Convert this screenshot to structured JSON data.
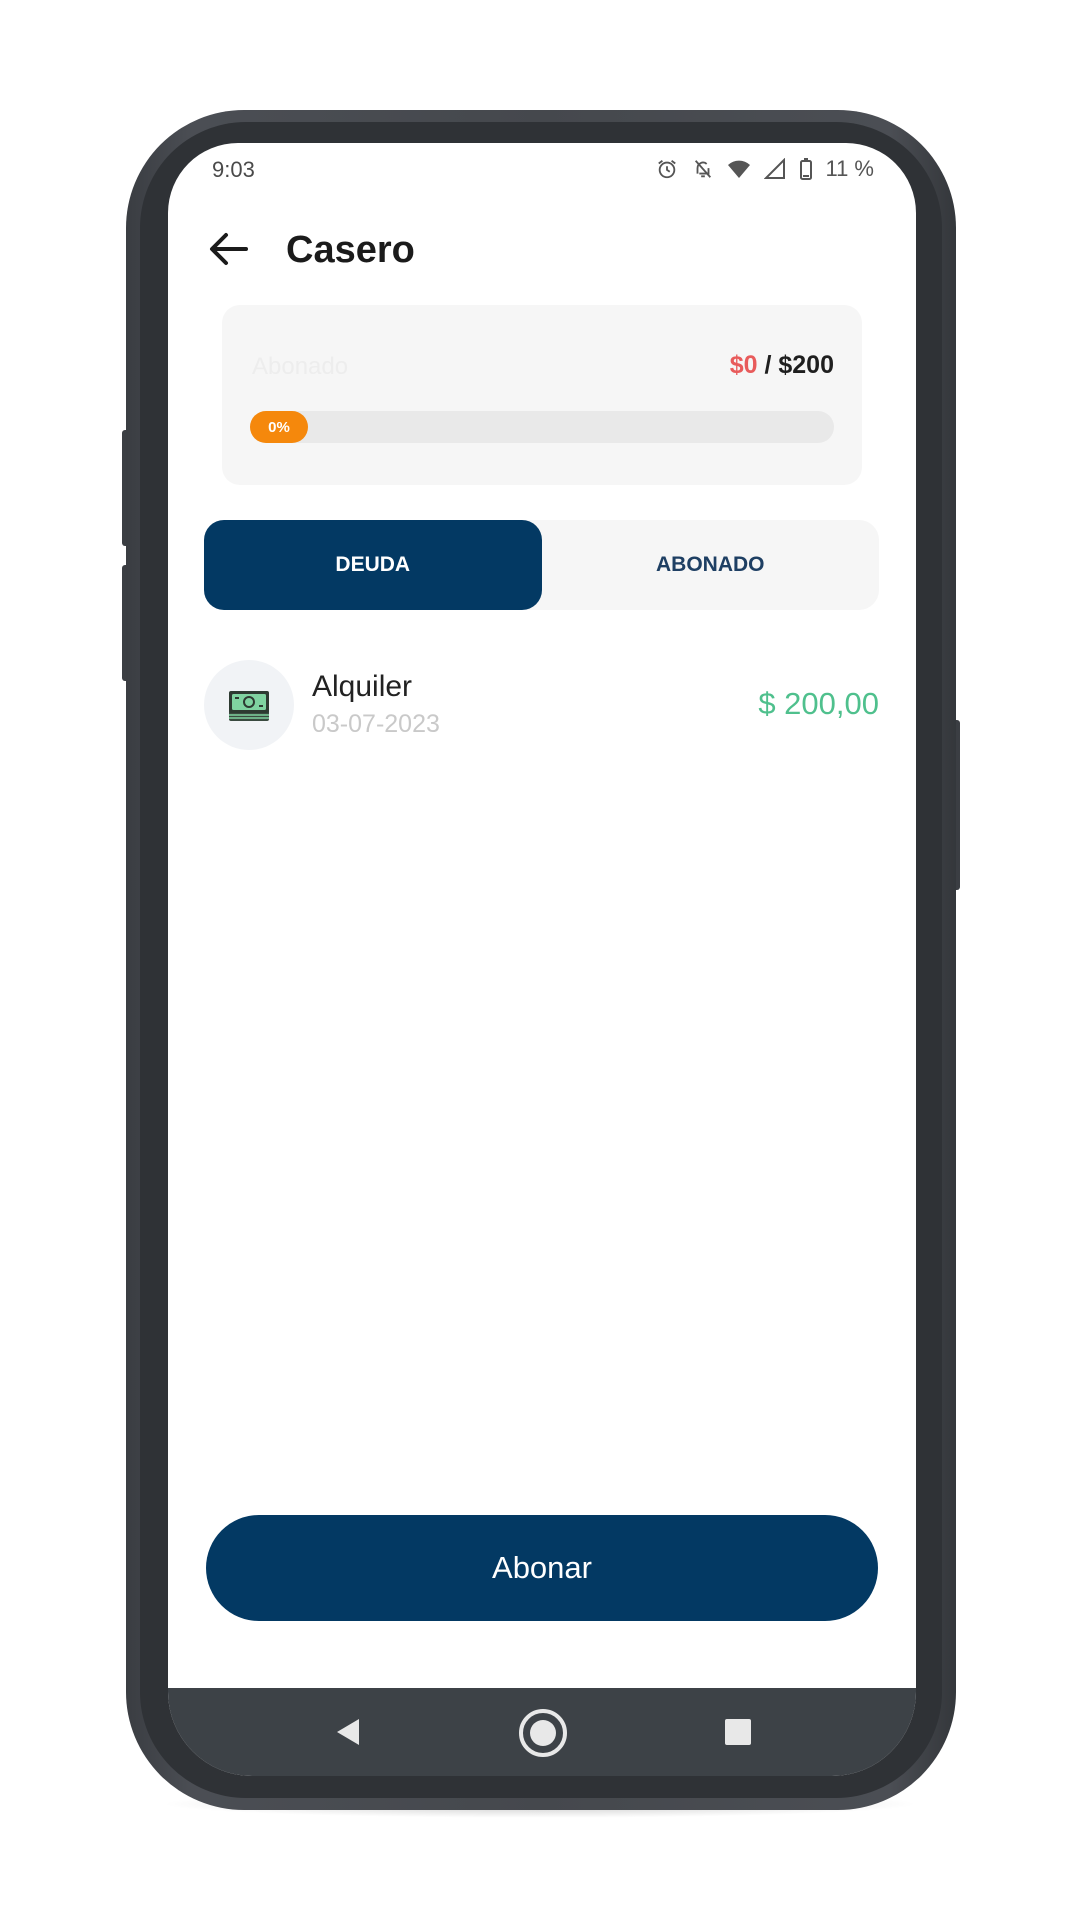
{
  "status_bar": {
    "time": "9:03",
    "battery_text": "11 %",
    "icons": [
      "alarm-icon",
      "notifications-off-icon",
      "wifi-icon",
      "signal-icon",
      "battery-icon"
    ]
  },
  "header": {
    "title": "Casero",
    "back_icon": "arrow-left-icon"
  },
  "summary_card": {
    "label": "Abonado",
    "paid_amount": "$0",
    "separator": " / ",
    "total_amount": "$200",
    "progress_percent": 0,
    "progress_label": "0%",
    "colors": {
      "paid": "#e85b5b",
      "progress": "#f5880c"
    }
  },
  "tabs": [
    {
      "label": "DEUDA",
      "active": true
    },
    {
      "label": "ABONADO",
      "active": false
    }
  ],
  "items": [
    {
      "icon": "cash-icon",
      "name": "Alquiler",
      "date": "03-07-2023",
      "amount": "$ 200,00"
    }
  ],
  "primary_button": {
    "label": "Abonar"
  },
  "nav_bar": {
    "icons": [
      "nav-back-icon",
      "nav-home-icon",
      "nav-recent-icon"
    ]
  },
  "colors": {
    "brand": "#033963",
    "amount_positive": "#4fc08d",
    "navbar": "#3d4247"
  }
}
